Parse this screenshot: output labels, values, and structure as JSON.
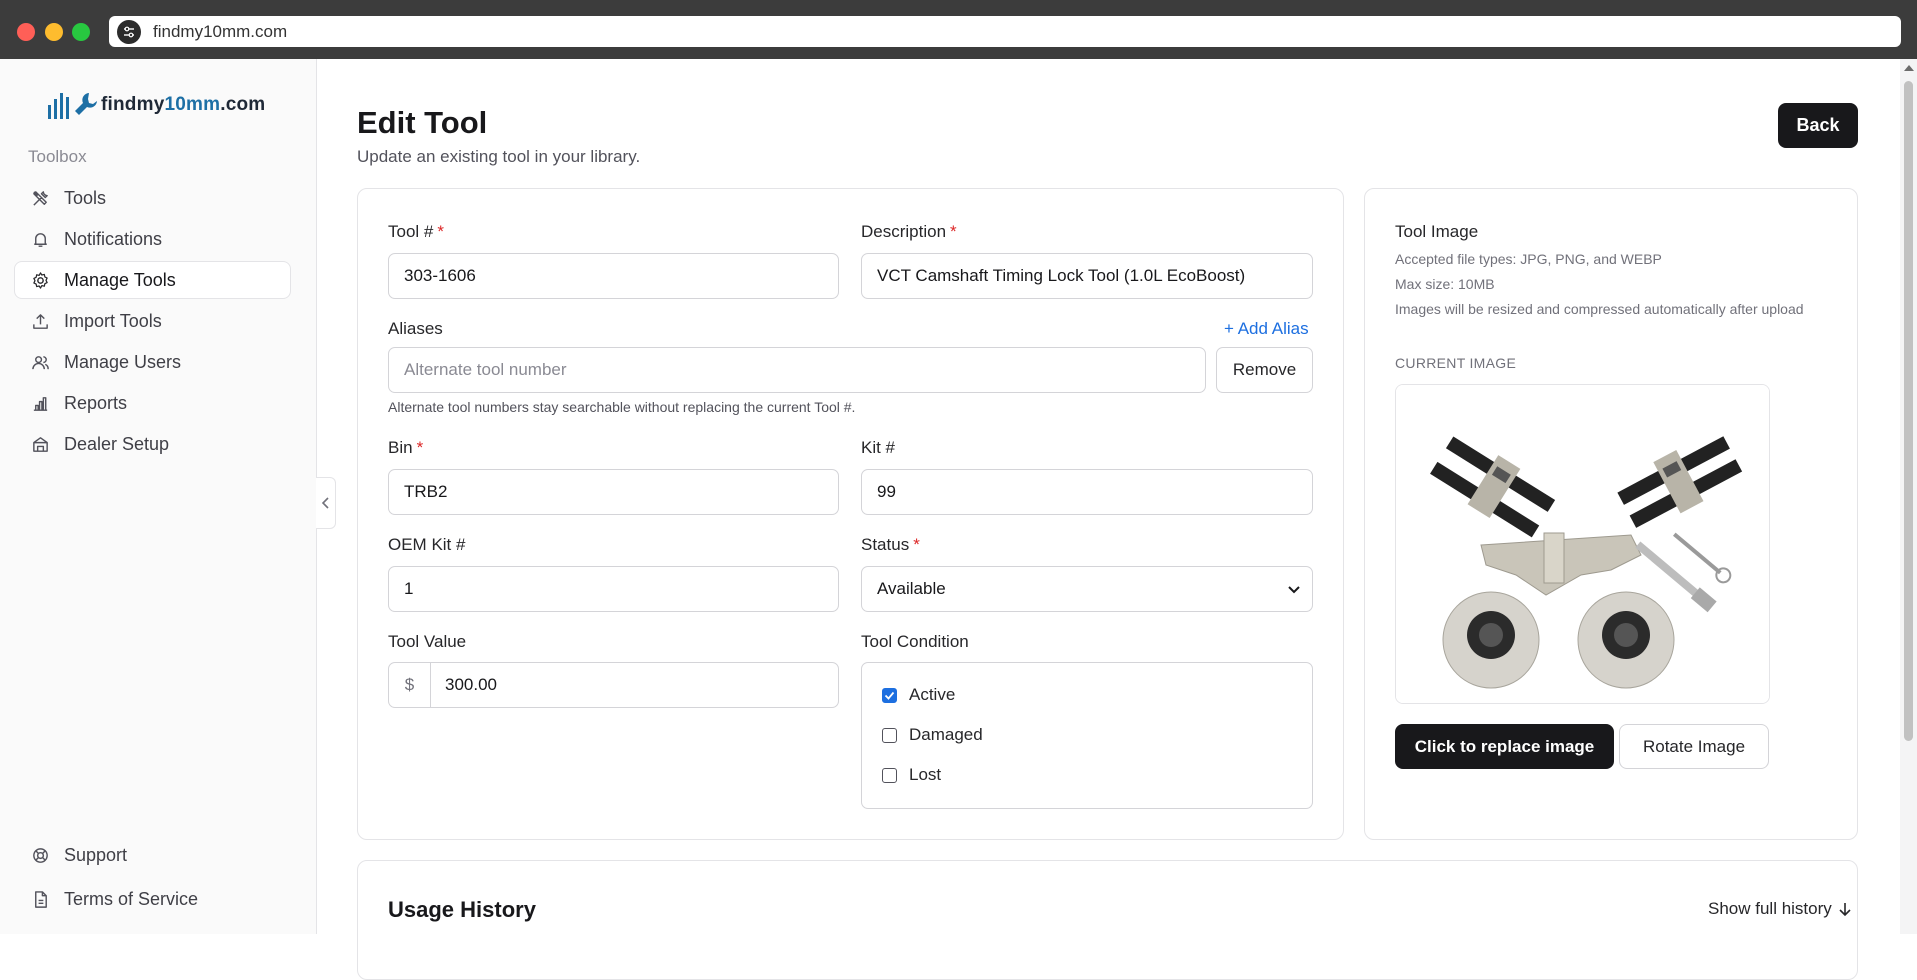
{
  "browser": {
    "url": "findmy10mm.com",
    "site_icon": "sliders-icon"
  },
  "sidebar": {
    "logo": {
      "text_prefix": "findmy",
      "text_accent": "10mm",
      "text_suffix": ".com",
      "accent_color": "#1d6fa5"
    },
    "section_label": "Toolbox",
    "items": [
      {
        "label": "Tools",
        "icon": "tools-icon",
        "active": false
      },
      {
        "label": "Notifications",
        "icon": "bell-icon",
        "active": false
      },
      {
        "label": "Manage Tools",
        "icon": "gear-icon",
        "active": true
      },
      {
        "label": "Import Tools",
        "icon": "upload-icon",
        "active": false
      },
      {
        "label": "Manage Users",
        "icon": "users-icon",
        "active": false
      },
      {
        "label": "Reports",
        "icon": "bar-chart-icon",
        "active": false
      },
      {
        "label": "Dealer Setup",
        "icon": "building-icon",
        "active": false
      }
    ],
    "bottom_items": [
      {
        "label": "Support",
        "icon": "lifebuoy-icon"
      },
      {
        "label": "Terms of Service",
        "icon": "document-icon"
      }
    ]
  },
  "header": {
    "title": "Edit Tool",
    "subtitle": "Update an existing tool in your library.",
    "back_label": "Back"
  },
  "form": {
    "tool_number": {
      "label": "Tool #",
      "value": "303-1606"
    },
    "description": {
      "label": "Description",
      "value": "VCT Camshaft Timing Lock Tool (1.0L EcoBoost)"
    },
    "aliases": {
      "label": "Aliases",
      "add_label": "+ Add Alias",
      "placeholder": "Alternate tool number",
      "remove_label": "Remove",
      "hint": "Alternate tool numbers stay searchable without replacing the current Tool #."
    },
    "bin": {
      "label": "Bin",
      "value": "TRB2"
    },
    "kit_number": {
      "label": "Kit #",
      "value": "99"
    },
    "oem_kit_number": {
      "label": "OEM Kit #",
      "value": "1"
    },
    "status": {
      "label": "Status",
      "value": "Available"
    },
    "tool_value": {
      "label": "Tool Value",
      "prefix": "$",
      "value": "300.00"
    },
    "condition": {
      "label": "Tool Condition",
      "options": [
        {
          "label": "Active",
          "checked": true
        },
        {
          "label": "Damaged",
          "checked": false
        },
        {
          "label": "Lost",
          "checked": false
        }
      ]
    },
    "required_marker": "*"
  },
  "image_panel": {
    "title": "Tool Image",
    "accepted": "Accepted file types: JPG, PNG, and WEBP",
    "max_size": "Max size: 10MB",
    "resize_note": "Images will be resized and compressed automatically after upload",
    "current_label": "CURRENT IMAGE",
    "replace_label": "Click to replace image",
    "rotate_label": "Rotate Image"
  },
  "usage": {
    "title": "Usage History",
    "show_full_label": "Show full history"
  },
  "colors": {
    "primary_dark": "#18181b",
    "link_blue": "#1d6fe0",
    "required_red": "#dc2626"
  }
}
